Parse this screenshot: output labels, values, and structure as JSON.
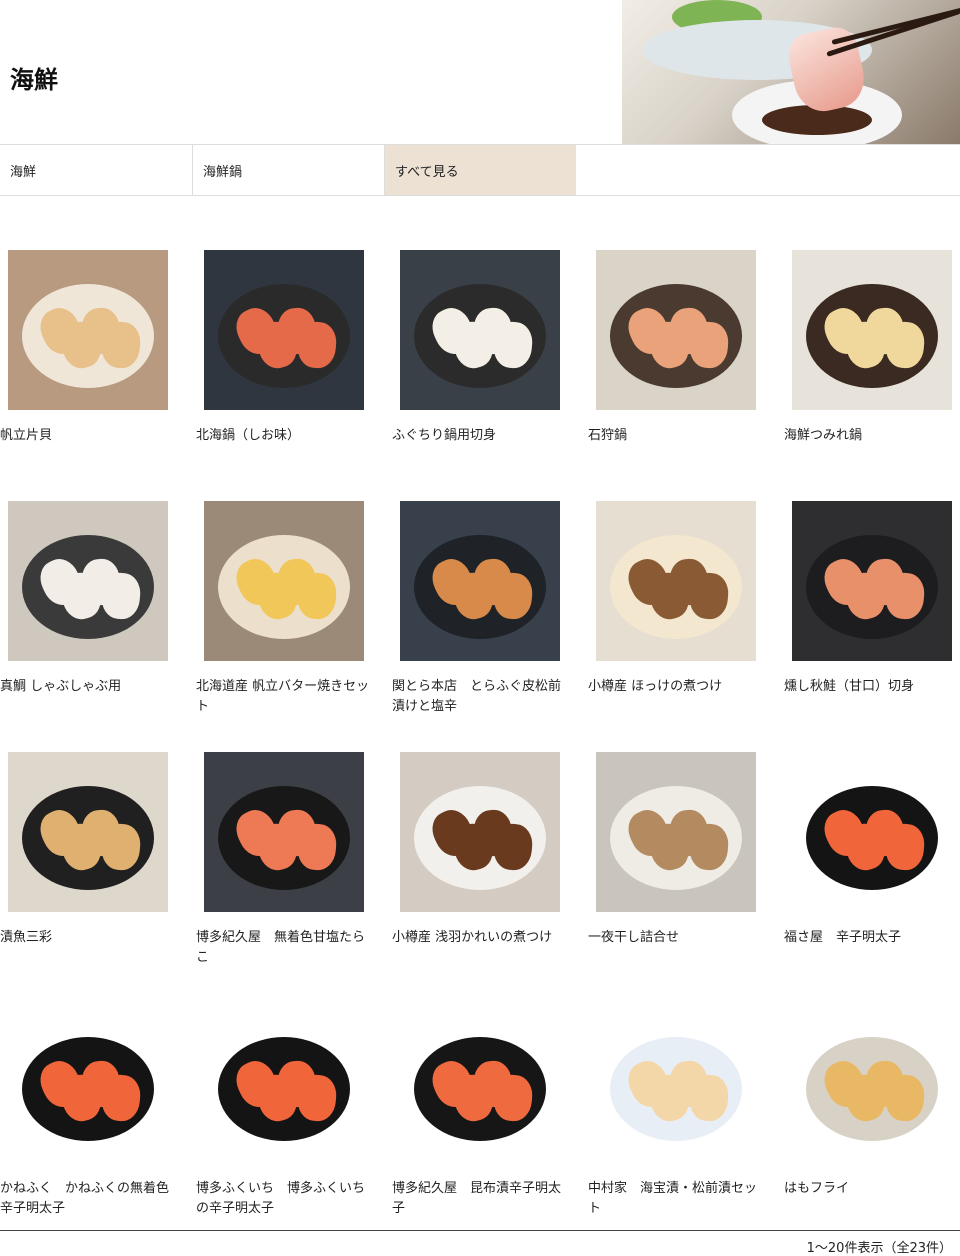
{
  "page_title": "海鮮",
  "tabs": [
    {
      "label": "海鮮"
    },
    {
      "label": "海鮮鍋"
    },
    {
      "label": "すべて見る"
    }
  ],
  "products": [
    {
      "name": "帆立片貝",
      "icon": "scallop-shell-photo"
    },
    {
      "name": "北海鍋（しお味）",
      "icon": "crab-hotpot-photo"
    },
    {
      "name": "ふぐちり鍋用切身",
      "icon": "pufferfish-hotpot-photo"
    },
    {
      "name": "石狩鍋",
      "icon": "salmon-hotpot-photo"
    },
    {
      "name": "海鮮つみれ鍋",
      "icon": "fishball-hotpot-photo"
    },
    {
      "name": "真鯛 しゃぶしゃぶ用",
      "icon": "sea-bream-shabu-photo"
    },
    {
      "name": "北海道産 帆立バター焼きセット",
      "icon": "scallop-butter-photo"
    },
    {
      "name": "関とら本店　とらふぐ皮松前漬けと塩辛",
      "icon": "fugu-skin-photo"
    },
    {
      "name": "小樽産 ほっけの煮つけ",
      "icon": "simmered-hokke-photo"
    },
    {
      "name": "燻し秋鮭（甘口）切身",
      "icon": "smoked-salmon-photo"
    },
    {
      "name": "漬魚三彩",
      "icon": "marinated-fish-photo"
    },
    {
      "name": "博多紀久屋　無着色甘塩たらこ",
      "icon": "tarako-photo"
    },
    {
      "name": "小樽産 浅羽かれいの煮つけ",
      "icon": "simmered-flounder-photo"
    },
    {
      "name": "一夜干し詰合せ",
      "icon": "dried-fish-photo"
    },
    {
      "name": "福さ屋　辛子明太子",
      "icon": "mentaiko-photo"
    },
    {
      "name": "かねふく　かねふくの無着色辛子明太子",
      "icon": "mentaiko-photo"
    },
    {
      "name": "博多ふくいち　博多ふくいちの辛子明太子",
      "icon": "mentaiko-photo"
    },
    {
      "name": "博多紀久屋　昆布漬辛子明太子",
      "icon": "kombu-mentaiko-photo"
    },
    {
      "name": "中村家　海宝漬・松前漬セット",
      "icon": "seafood-bowl-photo"
    },
    {
      "name": "はもフライ",
      "icon": "fried-pike-conger-photo"
    }
  ],
  "pagination": {
    "summary": "1～20件表示（全23件）"
  }
}
